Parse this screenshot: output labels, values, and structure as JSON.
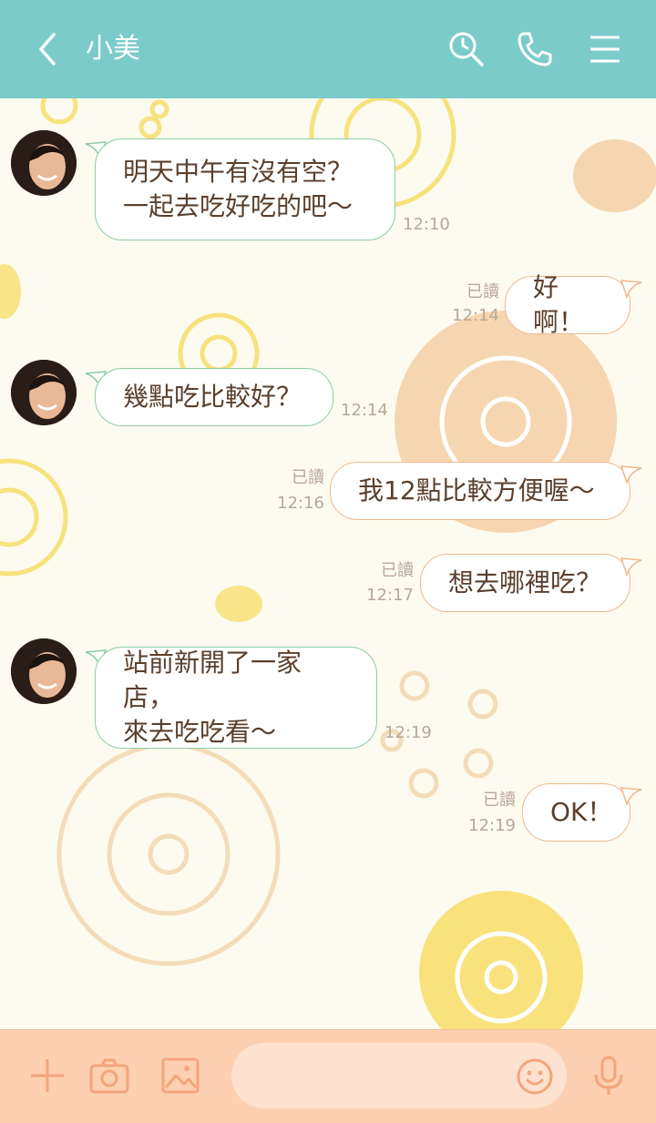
{
  "header": {
    "title": "小美"
  },
  "messages": [
    {
      "lines": [
        "明天中午有沒有空？",
        "一起去吃好吃的吧～"
      ],
      "time": "12:10"
    },
    {
      "lines": [
        "好啊！"
      ],
      "read": "已讀",
      "time": "12:14"
    },
    {
      "lines": [
        "幾點吃比較好？"
      ],
      "time": "12:14"
    },
    {
      "lines": [
        "我12點比較方便喔～"
      ],
      "read": "已讀",
      "time": "12:16"
    },
    {
      "lines": [
        "想去哪裡吃？"
      ],
      "read": "已讀",
      "time": "12:17"
    },
    {
      "lines": [
        "站前新開了一家店，",
        "來去吃吃看～"
      ],
      "time": "12:19"
    },
    {
      "lines": [
        "OK！"
      ],
      "read": "已讀",
      "time": "12:19"
    }
  ],
  "footer": {
    "input_placeholder": ""
  },
  "colors": {
    "header": "#7ccbcb",
    "footer": "#fcd0b0",
    "incoming_border": "#8fcca4",
    "outgoing_border": "#f0b98a"
  },
  "icons": [
    "back-icon",
    "search-icon",
    "phone-icon",
    "menu-icon",
    "plus-icon",
    "camera-icon",
    "image-icon",
    "emoji-icon",
    "mic-icon"
  ]
}
